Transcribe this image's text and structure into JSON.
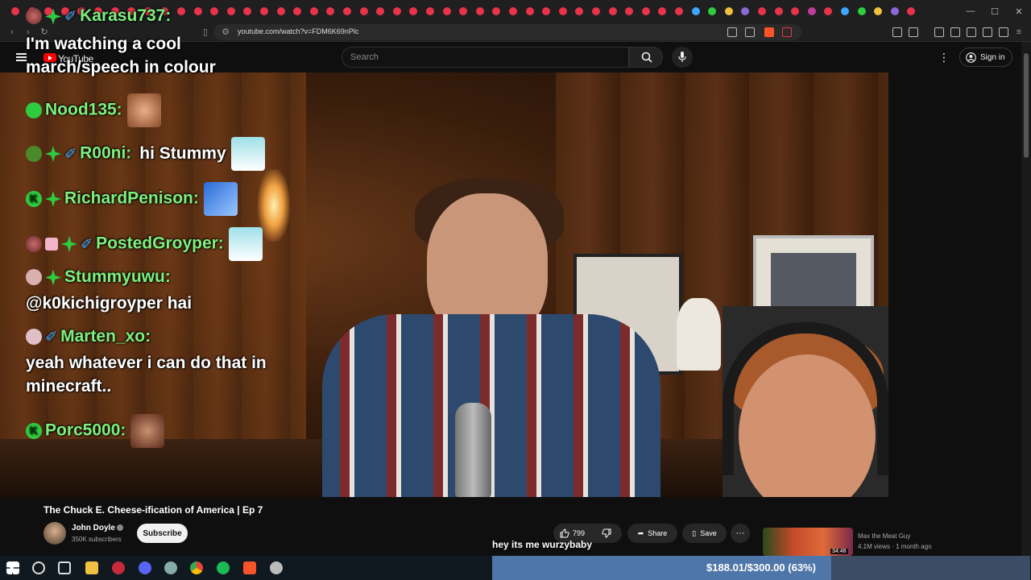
{
  "browser": {
    "url": "youtube.com/watch?v=FDM6K69nPlc"
  },
  "youtube": {
    "logo_text": "YouTube",
    "search_placeholder": "Search",
    "sign_in_label": "Sign in"
  },
  "chat": [
    {
      "name": "Karasu737:",
      "message": "I'm watching a cool march/speech in colour"
    },
    {
      "name": "Nood135:",
      "message": ""
    },
    {
      "name": "R00ni:",
      "message": "hi Stummy"
    },
    {
      "name": "RichardPenison:",
      "message": ""
    },
    {
      "name": "PostedGroyper:",
      "message": ""
    },
    {
      "name": "Stummyuwu:",
      "message": "@k0kichigroyper hai"
    },
    {
      "name": "Marten_xo:",
      "message": "yeah whatever i can do that in minecraft.."
    },
    {
      "name": "Porc5000:",
      "message": ""
    }
  ],
  "video": {
    "title": "The Chuck E. Cheese-ification of America | Ep 7",
    "channel_name": "John Doyle",
    "subscribers": "350K subscribers",
    "subscribe_label": "Subscribe",
    "like_count": "799",
    "share_label": "Share",
    "save_label": "Save",
    "caption": "hey its me wurzybaby"
  },
  "recommended": {
    "duration": "34:48",
    "channel": "Max the Meat Guy",
    "meta": "4.1M views · 1 month ago"
  },
  "taskbar": {
    "donation_text": "$188.01/$300.00 (63%)",
    "donation_progress": 0.63
  },
  "colors": {
    "chat_name": "#7df07d",
    "youtube_red": "#ff0000",
    "progress_fill": "#4f76a8"
  }
}
